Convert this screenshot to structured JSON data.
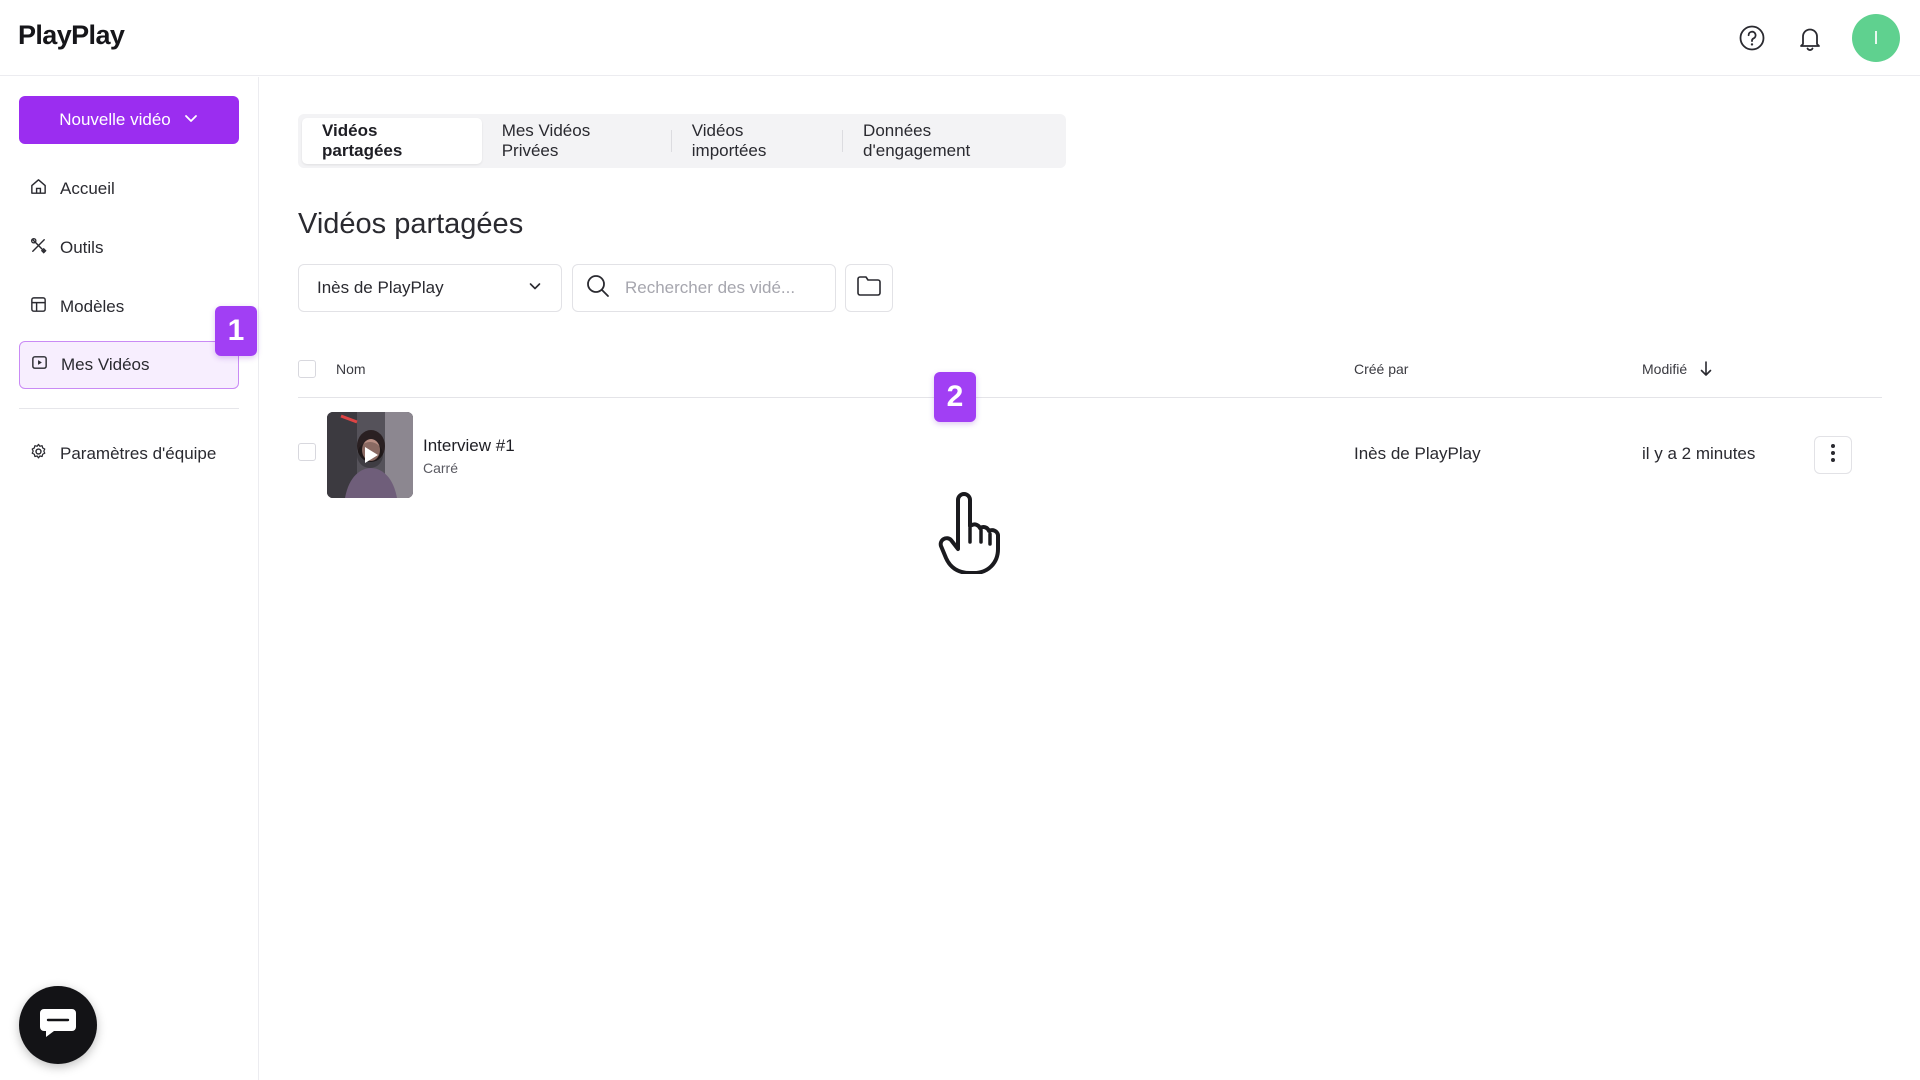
{
  "header": {
    "logo_text": "PlayPlay",
    "help_icon": "help-circle-icon",
    "notifications_icon": "bell-icon",
    "avatar_initial": "I",
    "avatar_color": "#5fd18f"
  },
  "sidebar": {
    "new_video_label": "Nouvelle vidéo",
    "accent_color": "#9b2df0",
    "items": [
      {
        "label": "Accueil",
        "icon": "home-icon",
        "active": false
      },
      {
        "label": "Outils",
        "icon": "tools-icon",
        "active": false
      },
      {
        "label": "Modèles",
        "icon": "templates-icon",
        "active": false
      },
      {
        "label": "Mes Vidéos",
        "icon": "video-icon",
        "active": true
      },
      {
        "label": "Paramètres d'équipe",
        "icon": "gear-icon",
        "active": false
      }
    ]
  },
  "tabs": [
    {
      "label": "Vidéos partagées",
      "active": true
    },
    {
      "label": "Mes Vidéos Privées",
      "active": false
    },
    {
      "label": "Vidéos importées",
      "active": false
    },
    {
      "label": "Données d'engagement",
      "active": false
    }
  ],
  "main": {
    "title": "Vidéos partagées",
    "owner_filter": "Inès de PlayPlay",
    "search_placeholder": "Rechercher des vidé..."
  },
  "table": {
    "columns": {
      "name": "Nom",
      "created_by": "Créé par",
      "modified": "Modifié"
    },
    "rows": [
      {
        "title": "Interview #1",
        "format": "Carré",
        "created_by": "Inès de PlayPlay",
        "modified": "il y a 2 minutes"
      }
    ]
  },
  "steps": {
    "one": "1",
    "two": "2"
  }
}
